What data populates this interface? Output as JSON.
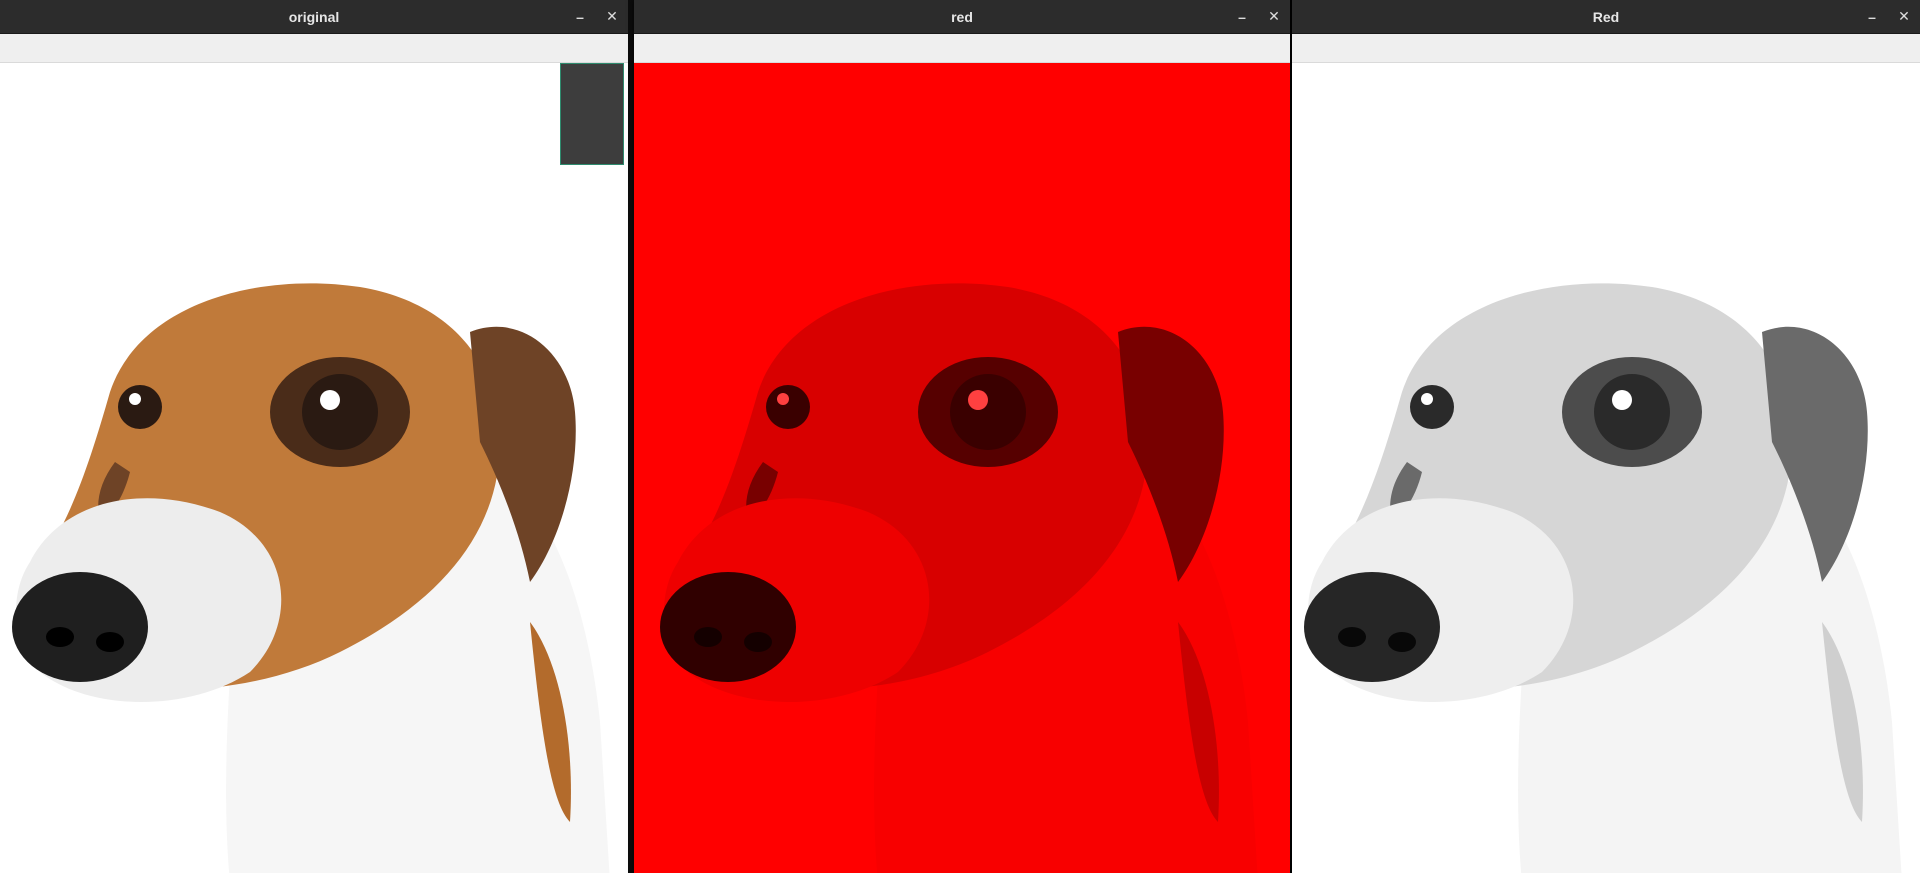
{
  "windows": [
    {
      "id": "original",
      "title": "original",
      "minimize_symbol": "–",
      "close_symbol": "✕"
    },
    {
      "id": "red",
      "title": "red",
      "minimize_symbol": "–",
      "close_symbol": "✕"
    },
    {
      "id": "redgray",
      "title": "Red",
      "minimize_symbol": "–",
      "close_symbol": "✕"
    }
  ],
  "images": {
    "original": {
      "subject": "dog-photo-color",
      "background": "#ffffff"
    },
    "red": {
      "subject": "dog-photo-red-channel",
      "background": "#ff0000"
    },
    "redgray": {
      "subject": "dog-photo-grayscale",
      "background": "#ffffff"
    }
  },
  "colors": {
    "titlebar_bg": "#2c2c2c",
    "titlebar_text": "#e6e6e6",
    "toolbar_bg": "#efefef",
    "red_channel": "#ff0000"
  }
}
